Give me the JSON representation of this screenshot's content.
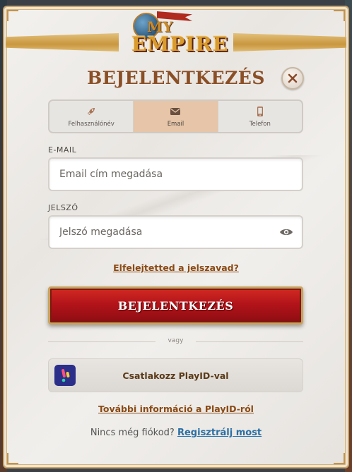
{
  "logo": {
    "text_top": "MY",
    "text_bottom": "EMPIRE"
  },
  "dialog": {
    "title": "BEJELENTKEZÉS"
  },
  "tabs": [
    {
      "label": "Felhasználónév",
      "icon": "rocket-icon",
      "active": false
    },
    {
      "label": "Email",
      "icon": "envelope-icon",
      "active": true
    },
    {
      "label": "Telefon",
      "icon": "phone-icon",
      "active": false
    }
  ],
  "email": {
    "label": "E-MAIL",
    "placeholder": "Email cím megadása",
    "value": ""
  },
  "password": {
    "label": "JELSZÓ",
    "placeholder": "Jelszó megadása",
    "value": ""
  },
  "forgot_link": "Elfelejtetted a jelszavad?",
  "login_button": "BEJELENTKEZÉS",
  "divider_text": "vagy",
  "playid_button": "Csatlakozz PlayID-val",
  "more_info_link": "További információ a PlayID-ról",
  "signup": {
    "prompt": "Nincs még fiókod?",
    "link": "Regisztrálj most"
  },
  "colors": {
    "accent_brown": "#8b4f26",
    "active_tab": "#e6c5a8",
    "login_red": "#b3141a",
    "link_blue": "#2a6fa5"
  }
}
